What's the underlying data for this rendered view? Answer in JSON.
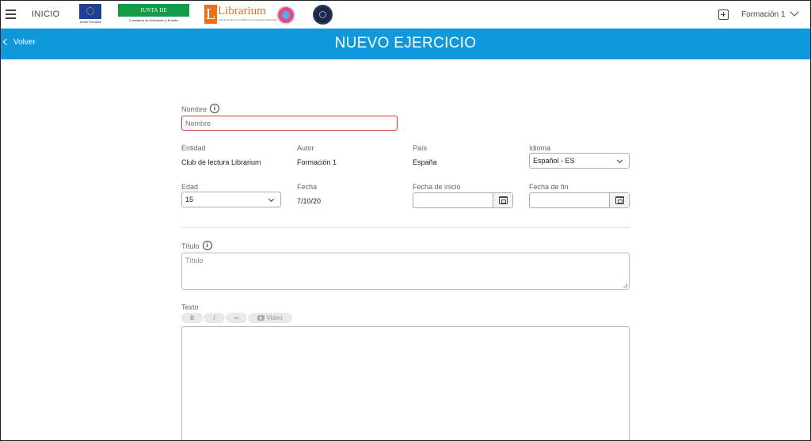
{
  "topbar": {
    "home_label": "INICIO",
    "logos": {
      "eu_caption": "Unión Europea",
      "junta_name": "JUNTA DE EXTREMADURA",
      "junta_caption": "Consejería de Educación y Empleo",
      "librarium_name": "Librarium",
      "librarium_caption": "Club de lectura de las Bibliotecas escolares extremeñas"
    },
    "user_name": "Formación 1"
  },
  "header": {
    "back_label": "Volver",
    "title": "NUEVO EJERCICIO"
  },
  "form": {
    "nombre": {
      "label": "Nombre",
      "placeholder": "Nombre",
      "value": ""
    },
    "entidad": {
      "label": "Entidad",
      "value": "Club de lectura Librarium"
    },
    "autor": {
      "label": "Autor",
      "value": "Formación 1"
    },
    "pais": {
      "label": "País",
      "value": "España"
    },
    "idioma": {
      "label": "Idioma",
      "value": "Español - ES"
    },
    "edad": {
      "label": "Edad",
      "value": "15"
    },
    "fecha": {
      "label": "Fecha",
      "value": "7/10/20"
    },
    "fecha_inicio": {
      "label": "Fecha de inicio",
      "value": ""
    },
    "fecha_fin": {
      "label": "Fecha de fin",
      "value": ""
    },
    "titulo": {
      "label": "Título",
      "placeholder": "Título",
      "value": ""
    },
    "texto": {
      "label": "Texto",
      "toolbar": {
        "bold": "B",
        "italic": "I",
        "link": "∞",
        "video": "Video"
      }
    }
  },
  "colors": {
    "header_blue": "#0f98dc",
    "error_red": "#d63a3a",
    "junta_green": "#149b47",
    "librarium_orange": "#e8711e"
  }
}
